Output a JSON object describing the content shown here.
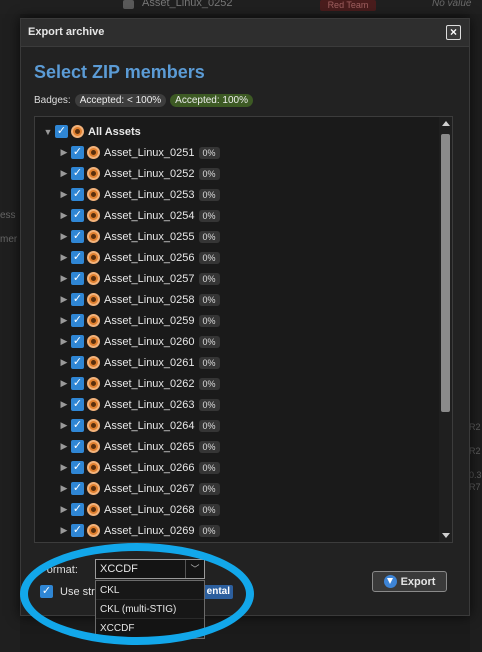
{
  "background": {
    "top_asset_label": "Asset_Linux_0252",
    "top_badge": "Red Team",
    "top_no_value": "No value",
    "left_fragments": [
      "ess",
      "mer"
    ],
    "right_fragments": [
      "R2",
      "R2",
      "0.3",
      "R7"
    ]
  },
  "modal": {
    "title": "Export archive",
    "heading": "Select ZIP members",
    "badges_label": "Badges:",
    "badge_partial": "Accepted: < 100%",
    "badge_full": "Accepted: 100%"
  },
  "tree": {
    "root_label": "All Assets",
    "items": [
      {
        "label": "Asset_Linux_0251",
        "pct": "0%"
      },
      {
        "label": "Asset_Linux_0252",
        "pct": "0%"
      },
      {
        "label": "Asset_Linux_0253",
        "pct": "0%"
      },
      {
        "label": "Asset_Linux_0254",
        "pct": "0%"
      },
      {
        "label": "Asset_Linux_0255",
        "pct": "0%"
      },
      {
        "label": "Asset_Linux_0256",
        "pct": "0%"
      },
      {
        "label": "Asset_Linux_0257",
        "pct": "0%"
      },
      {
        "label": "Asset_Linux_0258",
        "pct": "0%"
      },
      {
        "label": "Asset_Linux_0259",
        "pct": "0%"
      },
      {
        "label": "Asset_Linux_0260",
        "pct": "0%"
      },
      {
        "label": "Asset_Linux_0261",
        "pct": "0%"
      },
      {
        "label": "Asset_Linux_0262",
        "pct": "0%"
      },
      {
        "label": "Asset_Linux_0263",
        "pct": "0%"
      },
      {
        "label": "Asset_Linux_0264",
        "pct": "0%"
      },
      {
        "label": "Asset_Linux_0265",
        "pct": "0%"
      },
      {
        "label": "Asset_Linux_0266",
        "pct": "0%"
      },
      {
        "label": "Asset_Linux_0267",
        "pct": "0%"
      },
      {
        "label": "Asset_Linux_0268",
        "pct": "0%"
      },
      {
        "label": "Asset_Linux_0269",
        "pct": "0%"
      }
    ]
  },
  "footer": {
    "format_label": "Format:",
    "format_value": "XCCDF",
    "format_options": [
      "CKL",
      "CKL (multi-STIG)",
      "XCCDF"
    ],
    "use_label": "Use str",
    "incremental_badge": "ental",
    "export_label": "Export"
  },
  "colors": {
    "accent_heading": "#5b9bd5",
    "checkbox": "#2f86d4",
    "badge_full": "#3d5a24",
    "annotation": "#12a7ea"
  }
}
